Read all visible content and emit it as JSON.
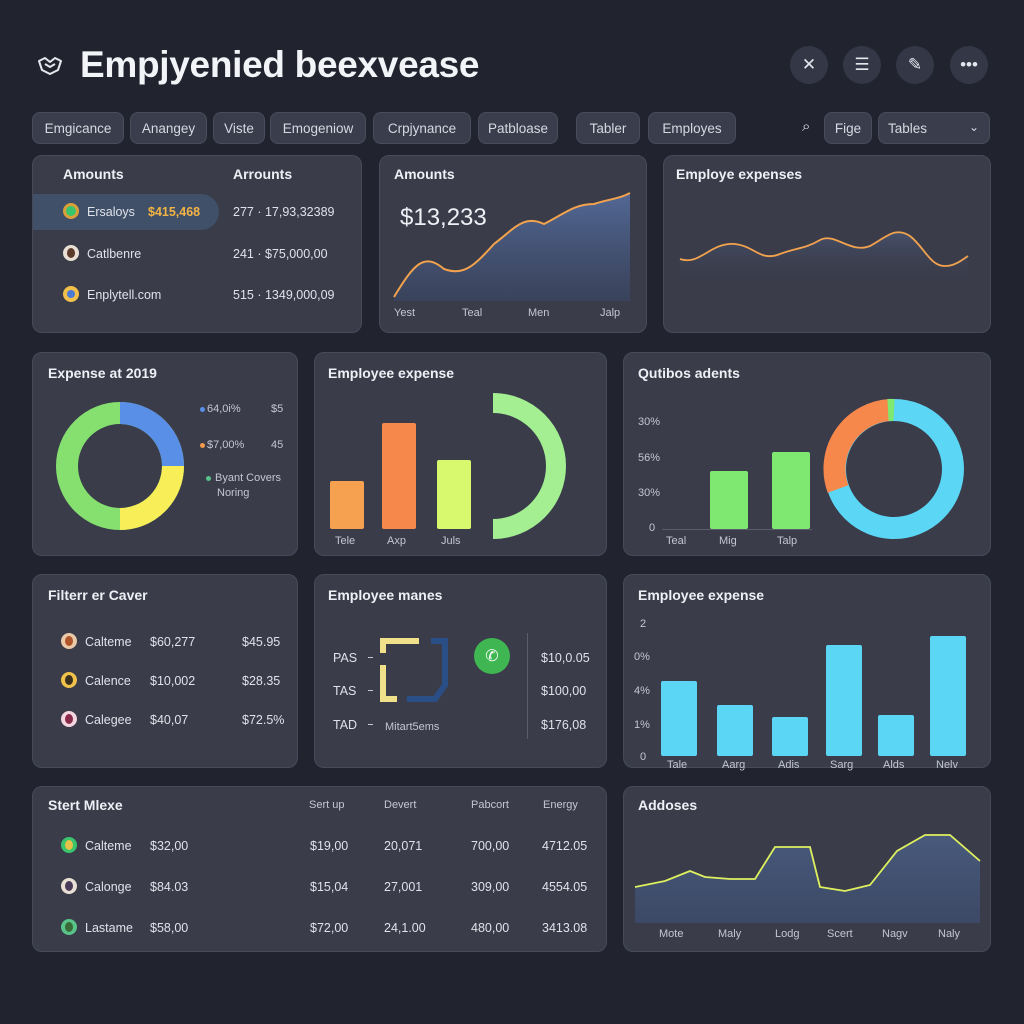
{
  "header": {
    "title": "Empjyenied beexvease"
  },
  "tabs": [
    "Emgicance",
    "Anangey",
    "Viste",
    "Emogeniow",
    "Crpjynance",
    "Patbloase",
    "Tabler",
    "Employes",
    "Fige"
  ],
  "select": {
    "value": "Tables"
  },
  "amounts_table": {
    "col1": "Amounts",
    "col2": "Arrounts",
    "rows": [
      {
        "name": "Ersaloys",
        "amount": "$415,468",
        "code": "277 · 17,93,32389",
        "selected": true
      },
      {
        "name": "Catlbenre",
        "amount": "",
        "code": "241 · $75,000,00",
        "selected": false
      },
      {
        "name": "Enplytell.com",
        "amount": "",
        "code": "515 · 1349,000,09",
        "selected": false
      }
    ]
  },
  "amounts_chart": {
    "title": "Amounts",
    "big_value": "$13,233",
    "x_labels": [
      "Yest",
      "Teal",
      "Men",
      "Jalp"
    ]
  },
  "employee_expenses": {
    "title": "Employe expenses"
  },
  "expense_2019": {
    "title": "Expense at 2019",
    "legend": [
      {
        "label": "64,0i%",
        "value": "$5",
        "color": "#5a8fe8"
      },
      {
        "label": "$7,00%",
        "value": "45",
        "color": "#f39a4c"
      },
      {
        "label": "Byant Covers",
        "value": "",
        "color": "#58c48a"
      },
      {
        "label": "Noring",
        "value": "",
        "color": ""
      }
    ]
  },
  "employee_expense_bars": {
    "title": "Employee expense",
    "x_labels": [
      "Tele",
      "Axp",
      "Juls"
    ]
  },
  "quarter_agents": {
    "title": "Qutibos adents",
    "y_labels": [
      "30%",
      "56%",
      "30%",
      "0"
    ],
    "x_labels": [
      "Teal",
      "Mig",
      "Talp"
    ]
  },
  "filter_cover": {
    "title": "Filterr er Caver",
    "rows": [
      {
        "name": "Calteme",
        "a": "$60,277",
        "b": "$45.95"
      },
      {
        "name": "Calence",
        "a": "$10,002",
        "b": "$28.35"
      },
      {
        "name": "Calegee",
        "a": "$40,07",
        "b": "$72.5%"
      }
    ]
  },
  "employee_manes": {
    "title": "Employee manes",
    "left_labels": [
      "PAS",
      "TAS",
      "TAD"
    ],
    "caption": "Mitart5ems",
    "right_values": [
      "$10,0.05",
      "$100,00",
      "$176,08"
    ]
  },
  "employee_expense_bars2": {
    "title": "Employee expense",
    "y_labels": [
      "2",
      "0%",
      "4%",
      "1%",
      "0"
    ],
    "x_labels": [
      "Tale",
      "Aarg",
      "Adis",
      "Sarg",
      "Alds",
      "Nelv"
    ]
  },
  "start_table": {
    "title": "Stert Mlexe",
    "columns": [
      "Sert up",
      "Devert",
      "Pabcort",
      "Energy"
    ],
    "rows": [
      {
        "name": "Calteme",
        "amount": "$32,00",
        "c1": "$19,00",
        "c2": "20,071",
        "c3": "700,00",
        "c4": "4712.05"
      },
      {
        "name": "Calonge",
        "amount": "$84.03",
        "c1": "$15,04",
        "c2": "27,001",
        "c3": "309,00",
        "c4": "4554.05"
      },
      {
        "name": "Lastame",
        "amount": "$58,00",
        "c1": "$72,00",
        "c2": "24,1.00",
        "c3": "480,00",
        "c4": "3413.08"
      }
    ]
  },
  "addoses": {
    "title": "Addoses",
    "x_labels": [
      "Mote",
      "Maly",
      "Lodg",
      "Scert",
      "Nagv",
      "Naly"
    ]
  },
  "chart_data": [
    {
      "type": "area",
      "title": "Amounts",
      "categories": [
        "Yest",
        "Teal",
        "Men",
        "Jalp"
      ],
      "series": [
        {
          "values": [
            8,
            48,
            38,
            68,
            74,
            96,
            82
          ]
        }
      ]
    },
    {
      "type": "line",
      "title": "Employe expenses",
      "series": [
        {
          "values": [
            50,
            70,
            55,
            68,
            52,
            64,
            50,
            58,
            38
          ]
        }
      ]
    },
    {
      "type": "pie",
      "title": "Expense at 2019",
      "series": [
        {
          "values": [
            25,
            25,
            50
          ]
        }
      ],
      "colors": [
        "#5a8fe8",
        "#f7ee58",
        "#85e070"
      ]
    },
    {
      "type": "bar",
      "title": "Employee expense",
      "categories": [
        "Tele",
        "Axp",
        "Juls"
      ],
      "values": [
        45,
        100,
        66
      ],
      "colors": [
        "#f5a14f",
        "#f7884c",
        "#d8f86e"
      ]
    },
    {
      "type": "bar",
      "title": "Qutibos adents",
      "categories": [
        "Teal",
        "Mig",
        "Talp"
      ],
      "values": [
        55,
        72
      ],
      "colors": [
        "#7ee870",
        "#7ee870"
      ]
    },
    {
      "type": "pie",
      "title": "Qutibos adents",
      "series": [
        {
          "values": [
            40,
            58,
            2
          ]
        }
      ],
      "colors": [
        "#f7884c",
        "#5bd6f5",
        "#7ee870"
      ]
    },
    {
      "type": "bar",
      "title": "Employee expense",
      "categories": [
        "Tale",
        "Aarg",
        "Adis",
        "Sarg",
        "Alds",
        "Nelv"
      ],
      "values": [
        62,
        42,
        32,
        92,
        34,
        99
      ],
      "colors": [
        "#5bd6f5"
      ]
    },
    {
      "type": "area",
      "title": "Addoses",
      "categories": [
        "Mote",
        "Maly",
        "Lodg",
        "Scert",
        "Nagv",
        "Naly"
      ],
      "series": [
        {
          "values": [
            20,
            30,
            10,
            80,
            20,
            60,
            90,
            50
          ]
        }
      ]
    }
  ]
}
